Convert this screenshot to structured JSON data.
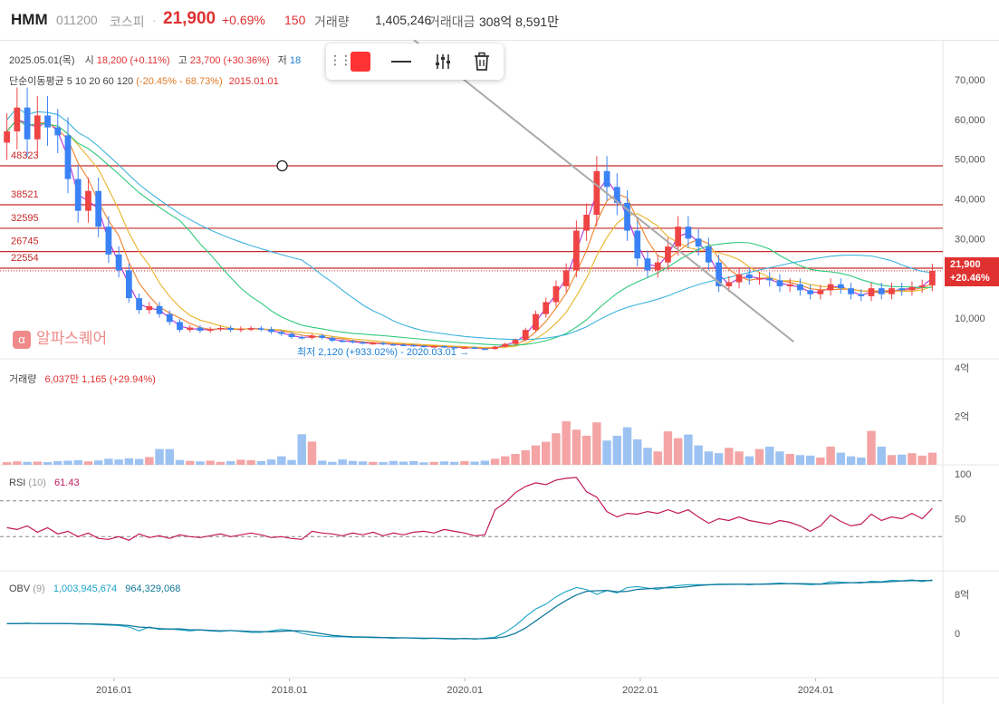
{
  "header": {
    "name": "HMM",
    "code": "011200",
    "market": "코스피",
    "dot": "·",
    "price": "21,900",
    "change_pct": "+0.69%",
    "diff": "150",
    "volume_label": "거래량",
    "volume_value": "1,405,246",
    "amount_label": "거래대금",
    "amount_value": "308억 8,591만"
  },
  "legend": {
    "date": "2025.05.01(목)",
    "open_label": "시",
    "open_value": "18,200 (+0.11%)",
    "high_label": "고",
    "high_value": "23,700 (+30.36%)",
    "low_label": "저",
    "low_value": "18",
    "ma_line": "단순이동평균 5 10 20 60 120",
    "ma_sub": "(-20.45% - 68.73%)",
    "ma_date": "2015.01.01"
  },
  "colors": {
    "up": "#ef4444",
    "down": "#3b82f6",
    "ma5": "#b430d6",
    "ma10": "#f0822b",
    "ma20": "#e9b42a",
    "ma60": "#2ec97b",
    "ma120": "#3cb3dd",
    "hline": "#c62828",
    "trendline": "#aaaaaa",
    "rsi": "#c2185b",
    "obv": "#1aa3c6",
    "obv_signal": "#137a9c"
  },
  "toolbar": {
    "grip_icon": "grip-dots-icon",
    "color_icon": "color-swatch-icon",
    "line_icon": "line-style-icon",
    "settings_icon": "sliders-icon",
    "delete_icon": "trash-icon"
  },
  "watermark": "알파스퀘어",
  "watermark_logo": "α",
  "min_annotation": "최저 2,120 (+933.02%) - 2020.03.01 →",
  "price_tag": {
    "price": "21,900",
    "pct": "+20.46%"
  },
  "chart_data": {
    "type": "candlestick",
    "interval": "monthly",
    "x_ticks": [
      "2016.01",
      "2018.01",
      "2020.01",
      "2022.01",
      "2024.01"
    ],
    "price_axis": {
      "ticks": [
        "70,000",
        "60,000",
        "50,000",
        "40,000",
        "30,000",
        "20,000",
        "10,000"
      ],
      "tick_values": [
        70000,
        60000,
        50000,
        40000,
        30000,
        20000,
        10000
      ],
      "ylim": [
        0,
        80000
      ]
    },
    "horizontal_lines": [
      "48323",
      "38521",
      "32595",
      "26745",
      "22554"
    ],
    "horizontal_line_values": [
      48323,
      38521,
      32595,
      26745,
      22554
    ],
    "trendline": {
      "from": [
        "2019.05",
        80000
      ],
      "to": [
        "2023.09",
        4000
      ]
    },
    "annotation_marker": {
      "at": "2018.01",
      "value": 48323
    },
    "min_point": {
      "value": 2120,
      "date": "2020.03.01"
    },
    "candles_close": [
      57000,
      63000,
      55000,
      61000,
      58000,
      56000,
      45000,
      37000,
      42000,
      33000,
      26000,
      22000,
      15000,
      12000,
      13000,
      11000,
      9000,
      7000,
      7600,
      6800,
      7200,
      7500,
      7000,
      7300,
      7400,
      7200,
      6500,
      6000,
      5200,
      5000,
      5600,
      5000,
      4300,
      4200,
      3900,
      3600,
      3700,
      3400,
      3300,
      3200,
      3000,
      2800,
      2900,
      2700,
      2500,
      2600,
      2300,
      2200,
      2800,
      3500,
      4500,
      7000,
      11000,
      14000,
      18000,
      22000,
      32000,
      36000,
      47000,
      43000,
      39000,
      32000,
      25000,
      22000,
      24000,
      28000,
      33000,
      30000,
      28000,
      24000,
      18000,
      19000,
      21000,
      20000,
      20000,
      19500,
      18000,
      18500,
      17000,
      16000,
      17000,
      18500,
      17500,
      16000,
      15500,
      17500,
      16000,
      17500,
      17000,
      17800,
      18200,
      21900
    ],
    "ma20_points": [
      [
        2016.0,
        48000
      ],
      [
        2017.0,
        10000
      ],
      [
        2018.0,
        5600
      ],
      [
        2019.0,
        4300
      ],
      [
        2020.2,
        3300
      ],
      [
        2021.0,
        6000
      ],
      [
        2022.0,
        25000
      ],
      [
        2023.0,
        21000
      ],
      [
        2024.0,
        18000
      ],
      [
        2025.3,
        19000
      ]
    ],
    "volume": {
      "label": "거래량",
      "legend": "6,037만 1,165 (+29.94%)",
      "ticks": [
        "4억",
        "2억"
      ],
      "tick_values": [
        400000000,
        200000000
      ],
      "values": [
        0.11,
        0.14,
        0.12,
        0.13,
        0.11,
        0.15,
        0.17,
        0.19,
        0.14,
        0.18,
        0.25,
        0.22,
        0.27,
        0.24,
        0.32,
        0.65,
        0.65,
        0.2,
        0.16,
        0.14,
        0.17,
        0.12,
        0.15,
        0.21,
        0.19,
        0.15,
        0.22,
        0.35,
        0.2,
        1.26,
        0.96,
        0.17,
        0.12,
        0.22,
        0.16,
        0.14,
        0.12,
        0.11,
        0.16,
        0.13,
        0.15,
        0.1,
        0.12,
        0.14,
        0.12,
        0.15,
        0.13,
        0.17,
        0.25,
        0.35,
        0.45,
        0.6,
        0.8,
        0.95,
        1.3,
        1.8,
        1.45,
        1.2,
        1.75,
        1.0,
        1.2,
        1.55,
        1.05,
        0.7,
        0.55,
        1.38,
        1.1,
        1.25,
        0.8,
        0.55,
        0.48,
        0.7,
        0.55,
        0.35,
        0.65,
        0.75,
        0.55,
        0.45,
        0.4,
        0.38,
        0.3,
        0.75,
        0.5,
        0.35,
        0.3,
        1.4,
        0.75,
        0.4,
        0.42,
        0.48,
        0.38,
        0.5
      ]
    },
    "rsi": {
      "label": "RSI",
      "period": "(10)",
      "value": "61.43",
      "ticks": [
        "100",
        "50"
      ],
      "tick_values": [
        100,
        50
      ],
      "bands": [
        70,
        30
      ],
      "values": [
        40,
        38,
        42,
        35,
        40,
        33,
        36,
        30,
        34,
        28,
        27,
        30,
        26,
        33,
        29,
        31,
        28,
        32,
        30,
        29,
        31,
        33,
        30,
        32,
        34,
        32,
        29,
        30,
        28,
        27,
        36,
        34,
        33,
        31,
        34,
        32,
        35,
        31,
        34,
        32,
        35,
        36,
        34,
        38,
        36,
        34,
        31,
        32,
        60,
        68,
        79,
        86,
        90,
        88,
        93,
        95,
        96,
        80,
        74,
        58,
        52,
        56,
        55,
        58,
        56,
        60,
        56,
        60,
        52,
        45,
        50,
        48,
        52,
        48,
        46,
        44,
        48,
        46,
        42,
        36,
        42,
        54,
        47,
        42,
        44,
        55,
        48,
        52,
        50,
        56,
        50,
        61.43
      ]
    },
    "obv": {
      "label": "OBV",
      "period": "(9)",
      "value1": "1,003,945,674",
      "value2": "964,329,068",
      "ticks": [
        "8억",
        "0"
      ],
      "tick_values": [
        800000000,
        0
      ],
      "values": [
        2.0,
        2.0,
        2.1,
        2.0,
        2.0,
        2.0,
        2.0,
        1.9,
        1.9,
        1.8,
        1.7,
        1.6,
        1.3,
        0.5,
        1.3,
        0.8,
        0.9,
        0.7,
        0.5,
        0.7,
        0.5,
        0.4,
        0.6,
        0.4,
        0.2,
        0.2,
        0.5,
        0.8,
        0.6,
        0.0,
        -0.4,
        -0.6,
        -0.7,
        -0.7,
        -0.8,
        -0.8,
        -0.9,
        -0.9,
        -1.0,
        -0.9,
        -1.0,
        -1.1,
        -1.0,
        -1.1,
        -1.2,
        -1.0,
        -1.2,
        -1.0,
        -0.8,
        0.2,
        1.6,
        3.4,
        5.0,
        6.0,
        7.5,
        8.6,
        9.4,
        9.0,
        8.0,
        8.8,
        8.3,
        9.4,
        9.6,
        9.3,
        9.0,
        9.5,
        9.8,
        10.0,
        10.0,
        10.0,
        10.1,
        10.1,
        10.1,
        10.0,
        10.1,
        10.2,
        10.3,
        10.2,
        10.1,
        10.0,
        10.1,
        10.6,
        10.5,
        10.4,
        10.3,
        10.7,
        10.6,
        10.9,
        10.8,
        11.0,
        10.6,
        11.0
      ]
    }
  }
}
